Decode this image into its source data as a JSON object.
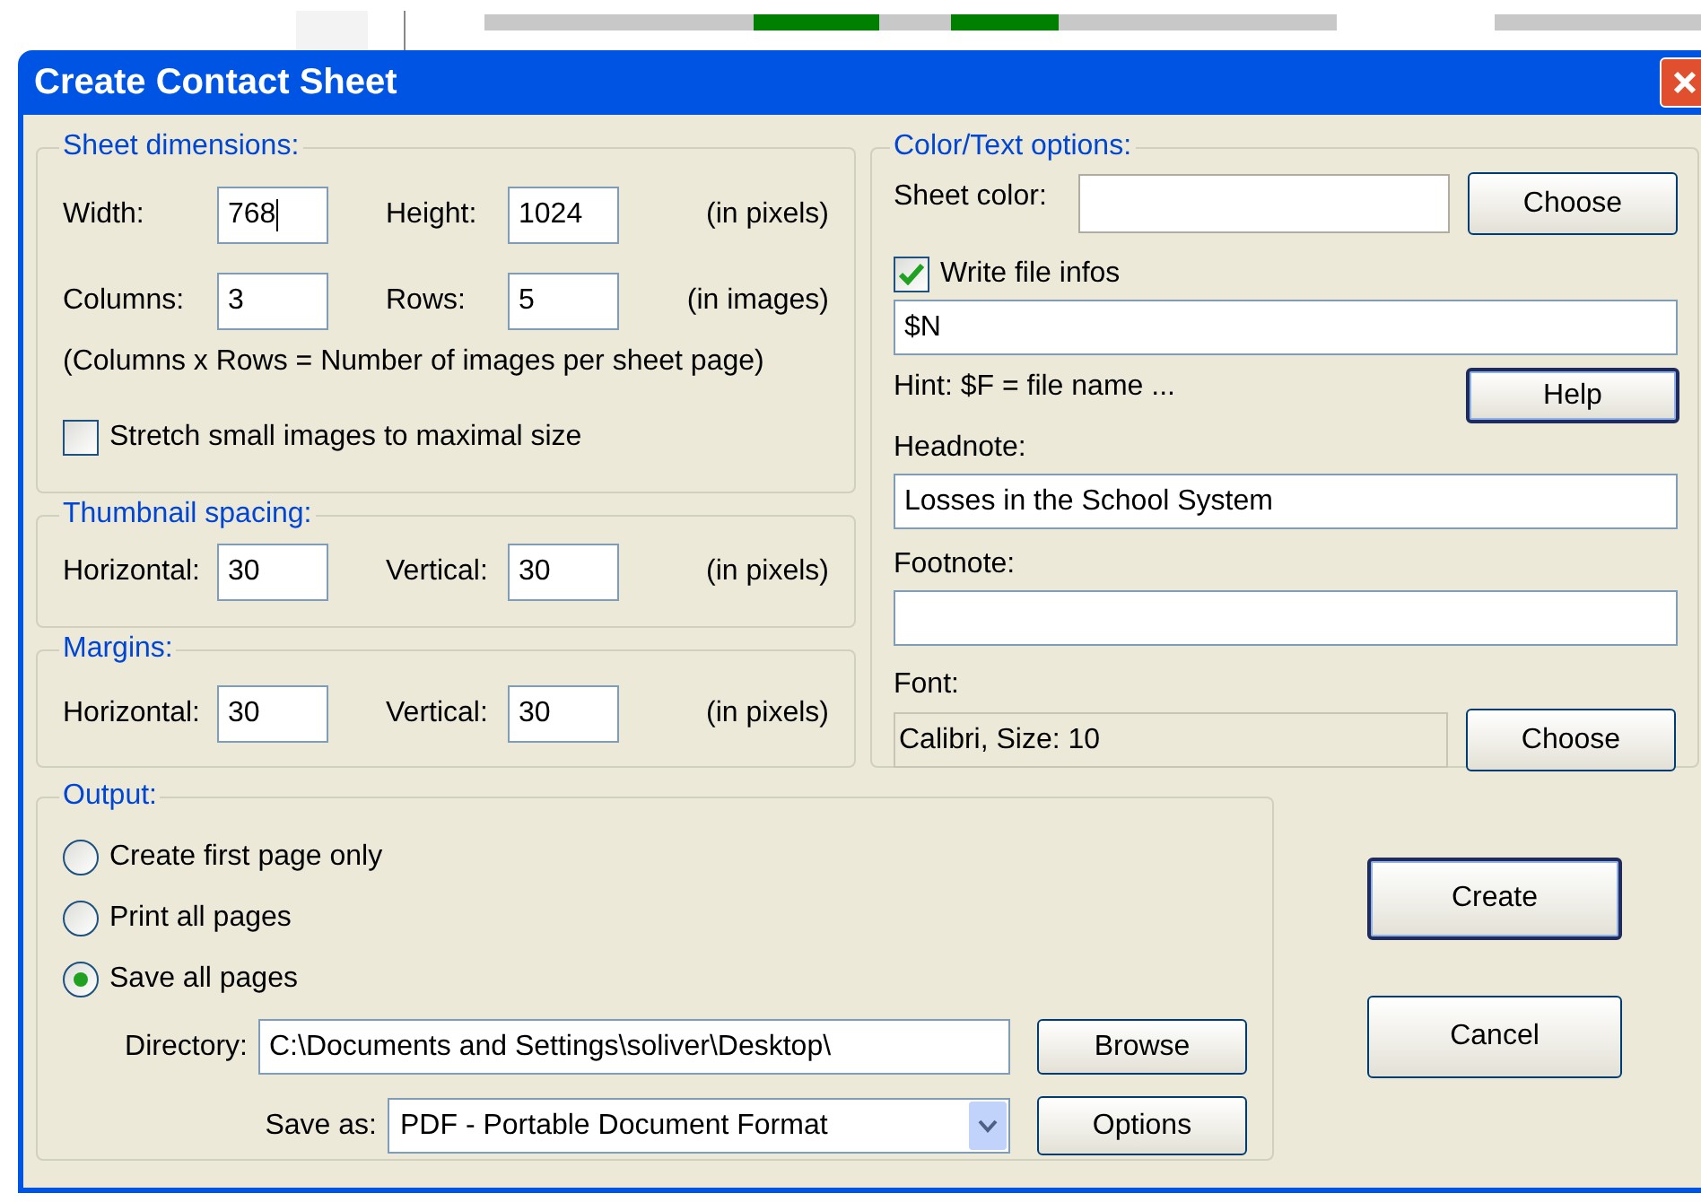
{
  "window": {
    "title": "Create Contact Sheet"
  },
  "sheet_dimensions": {
    "title": "Sheet dimensions:",
    "rows": [
      {
        "fields": [
          {
            "label": "Width:",
            "value": "768",
            "focused": true
          },
          {
            "label": "Height:",
            "value": "1024",
            "focused": false
          }
        ],
        "unit": "(in pixels)"
      },
      {
        "fields": [
          {
            "label": "Columns:",
            "value": "3",
            "focused": false
          },
          {
            "label": "Rows:",
            "value": "5",
            "focused": false
          }
        ],
        "unit": "(in images)"
      }
    ],
    "note": "(Columns x Rows = Number of images per sheet page)",
    "stretch": {
      "label": "Stretch small images to maximal size",
      "checked": false
    }
  },
  "thumbnail_spacing": {
    "title": "Thumbnail spacing:",
    "fields": [
      {
        "label": "Horizontal:",
        "value": "30",
        "focused": false
      },
      {
        "label": "Vertical:",
        "value": "30",
        "focused": false
      }
    ],
    "unit": "(in pixels)"
  },
  "margins": {
    "title": "Margins:",
    "fields": [
      {
        "label": "Horizontal:",
        "value": "30",
        "focused": false
      },
      {
        "label": "Vertical:",
        "value": "30",
        "focused": false
      }
    ],
    "unit": "(in pixels)"
  },
  "color_text_options": {
    "title": "Color/Text options:",
    "sheet_color": {
      "label": "Sheet color:",
      "button": {
        "label": "Choose",
        "focused": false
      }
    },
    "write_file_infos": {
      "label": "Write file infos",
      "checked": true
    },
    "file_info_value": "$N",
    "hint": "Hint: $F = file name ...",
    "help_button": {
      "label": "Help",
      "focused": true
    },
    "headnote": {
      "label": "Headnote:",
      "value": "Losses in the School System"
    },
    "footnote": {
      "label": "Footnote:"
    },
    "font": {
      "label": "Font:",
      "value": "Calibri, Size: 10",
      "button": {
        "label": "Choose",
        "focused": false
      }
    }
  },
  "output": {
    "title": "Output:",
    "options": [
      {
        "label": "Create first page only",
        "selected": false
      },
      {
        "label": "Print all pages",
        "selected": false
      },
      {
        "label": "Save all pages",
        "selected": true
      }
    ],
    "directory": {
      "label": "Directory:",
      "value": "C:\\Documents and Settings\\soliver\\Desktop\\"
    },
    "browse_button": {
      "label": "Browse",
      "focused": false
    },
    "save_as": {
      "label": "Save as:",
      "value": "PDF - Portable Document Format"
    },
    "options_button": {
      "label": "Options",
      "focused": false
    }
  },
  "buttons": [
    {
      "label": "Create",
      "focused": true
    },
    {
      "label": "Cancel",
      "focused": false
    }
  ]
}
